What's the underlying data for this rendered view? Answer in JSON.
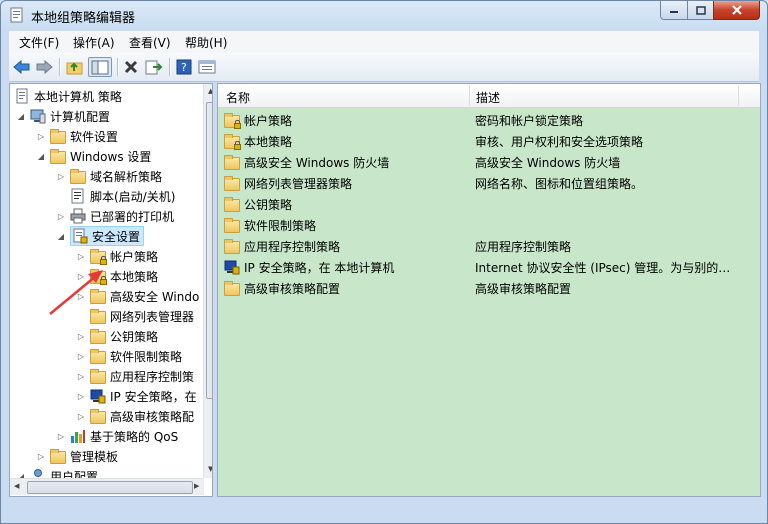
{
  "window": {
    "title": "本地组策略编辑器",
    "controls": {
      "minimize": "—",
      "maximize": "□",
      "close": "✕"
    }
  },
  "menu": [
    "文件(F)",
    "操作(A)",
    "查看(V)",
    "帮助(H)"
  ],
  "toolbar": {
    "buttons": [
      "back-arrow-icon",
      "forward-arrow-icon",
      "up-folder-icon",
      "show-tree-icon",
      "delete-icon",
      "export-icon",
      "help-icon",
      "properties-icon"
    ]
  },
  "tree": [
    {
      "label": "本地计算机 策略",
      "expander": ""
    },
    {
      "label": "计算机配置",
      "expander": "◢"
    },
    {
      "label": "软件设置",
      "expander": "▷"
    },
    {
      "label": "Windows 设置",
      "expander": "◢"
    },
    {
      "label": "域名解析策略",
      "expander": "▷"
    },
    {
      "label": "脚本(启动/关机)",
      "expander": ""
    },
    {
      "label": "已部署的打印机",
      "expander": "▷"
    },
    {
      "label": "安全设置",
      "expander": "◢"
    },
    {
      "label": "帐户策略",
      "expander": "▷"
    },
    {
      "label": "本地策略",
      "expander": "▷"
    },
    {
      "label": "高级安全 Windo",
      "expander": "▷"
    },
    {
      "label": "网络列表管理器",
      "expander": ""
    },
    {
      "label": "公钥策略",
      "expander": "▷"
    },
    {
      "label": "软件限制策略",
      "expander": "▷"
    },
    {
      "label": "应用程序控制策",
      "expander": "▷"
    },
    {
      "label": "IP 安全策略，在",
      "expander": "▷"
    },
    {
      "label": "高级审核策略配",
      "expander": "▷"
    },
    {
      "label": "基于策略的 QoS",
      "expander": "▷"
    },
    {
      "label": "管理模板",
      "expander": "▷"
    },
    {
      "label": "用户配置",
      "expander": "◢"
    }
  ],
  "list": {
    "columns": {
      "name": "名称",
      "description": "描述"
    },
    "rows": [
      {
        "name": "帐户策略",
        "description": "密码和帐户锁定策略"
      },
      {
        "name": "本地策略",
        "description": "审核、用户权利和安全选项策略"
      },
      {
        "name": "高级安全 Windows 防火墙",
        "description": "高级安全 Windows 防火墙"
      },
      {
        "name": "网络列表管理器策略",
        "description": "网络名称、图标和位置组策略。"
      },
      {
        "name": "公钥策略",
        "description": ""
      },
      {
        "name": "软件限制策略",
        "description": ""
      },
      {
        "name": "应用程序控制策略",
        "description": "应用程序控制策略"
      },
      {
        "name": "IP 安全策略，在 本地计算机",
        "description": "Internet 协议安全性 (IPsec) 管理。为与别的…"
      },
      {
        "name": "高级审核策略配置",
        "description": "高级审核策略配置"
      }
    ]
  },
  "colors": {
    "list_background": "#c8e6c9",
    "selection": "#cce8ff",
    "annotation_arrow": "#e53935"
  }
}
